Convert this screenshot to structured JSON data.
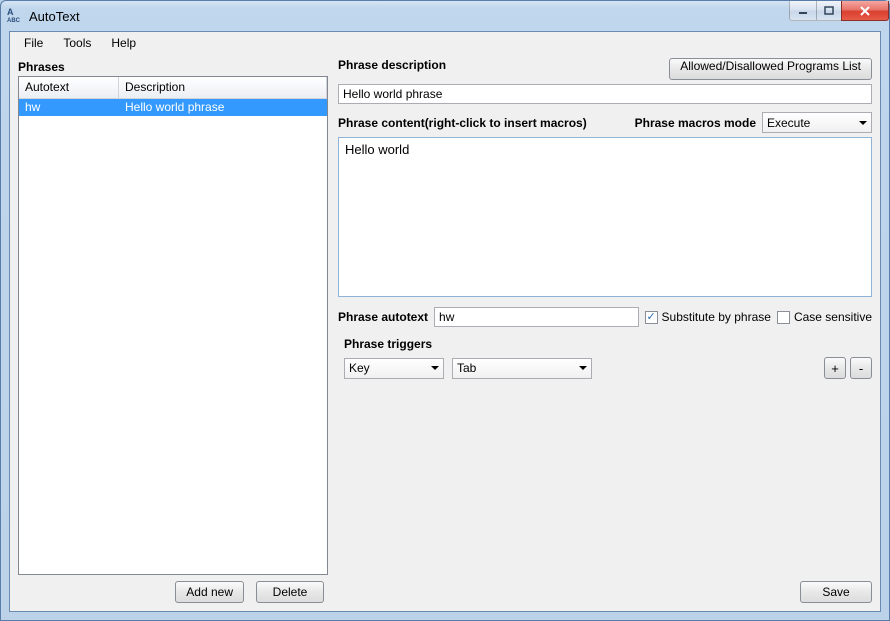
{
  "window": {
    "title": "AutoText"
  },
  "menu": {
    "file": "File",
    "tools": "Tools",
    "help": "Help"
  },
  "left": {
    "phrases_label": "Phrases",
    "col_autotext": "Autotext",
    "col_description": "Description",
    "rows": [
      {
        "autotext": "hw",
        "description": "Hello world phrase"
      }
    ],
    "add_new": "Add new",
    "delete": "Delete"
  },
  "right": {
    "phrase_description_label": "Phrase description",
    "phrase_description_value": "Hello world phrase",
    "allowed_button": "Allowed/Disallowed Programs List",
    "phrase_content_label": "Phrase content(right-click to insert macros)",
    "macros_mode_label": "Phrase macros mode",
    "macros_mode_value": "Execute",
    "phrase_content_value": "Hello world",
    "phrase_autotext_label": "Phrase autotext",
    "phrase_autotext_value": "hw",
    "substitute_label": "Substitute by phrase",
    "substitute_checked": true,
    "case_sensitive_label": "Case sensitive",
    "case_sensitive_checked": false,
    "triggers_label": "Phrase triggers",
    "trigger_type": "Key",
    "trigger_key": "Tab",
    "plus": "+",
    "minus": "-",
    "save": "Save"
  }
}
